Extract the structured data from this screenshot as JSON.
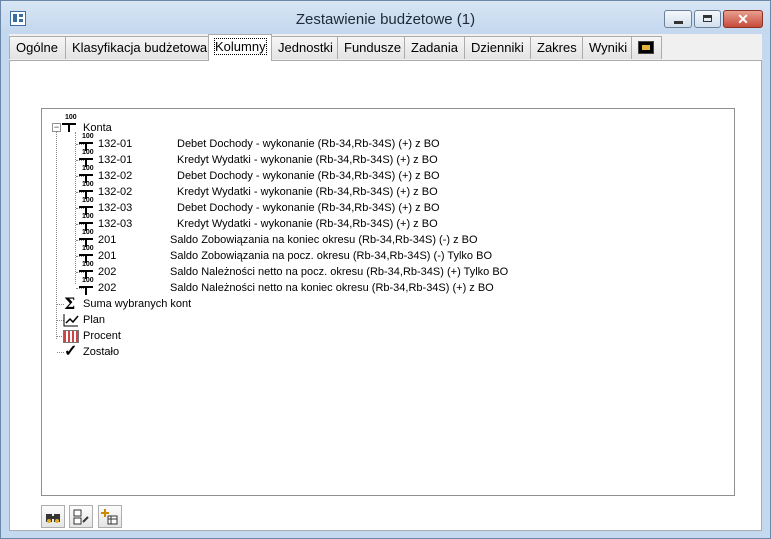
{
  "window": {
    "title": "Zestawienie budżetowe (1)",
    "close_glyph": "✕"
  },
  "tabs": [
    {
      "label": "Ogólne",
      "active": false
    },
    {
      "label": "Klasyfikacja budżetowa",
      "active": false
    },
    {
      "label": "Kolumny",
      "active": true
    },
    {
      "label": "Jednostki",
      "active": false
    },
    {
      "label": "Fundusze",
      "active": false
    },
    {
      "label": "Zadania",
      "active": false
    },
    {
      "label": "Dzienniki",
      "active": false
    },
    {
      "label": "Zakres",
      "active": false
    },
    {
      "label": "Wyniki",
      "active": false
    }
  ],
  "extra_tab_icon": "film-icon",
  "tree": {
    "root": {
      "label": "Konta",
      "icon_text": "100",
      "expander": "−"
    },
    "accounts": [
      {
        "code": "132-01",
        "desc": "Debet Dochody - wykonanie (Rb-34,Rb-34S) (+) z BO"
      },
      {
        "code": "132-01",
        "desc": "Kredyt Wydatki - wykonanie (Rb-34,Rb-34S) (+) z BO"
      },
      {
        "code": "132-02",
        "desc": "Debet Dochody - wykonanie (Rb-34,Rb-34S) (+) z BO"
      },
      {
        "code": "132-02",
        "desc": "Kredyt Wydatki - wykonanie (Rb-34,Rb-34S) (+) z BO"
      },
      {
        "code": "132-03",
        "desc": "Debet Dochody - wykonanie (Rb-34,Rb-34S) (+) z BO"
      },
      {
        "code": "132-03",
        "desc": "Kredyt Wydatki - wykonanie (Rb-34,Rb-34S) (+) z BO"
      },
      {
        "code": "201",
        "desc": "Saldo Zobowiązania na koniec okresu (Rb-34,Rb-34S) (-) z BO"
      },
      {
        "code": "201",
        "desc": "Saldo Zobowiązania na pocz. okresu (Rb-34,Rb-34S) (-) Tylko BO"
      },
      {
        "code": "202",
        "desc": "Saldo Należności netto  na pocz. okresu (Rb-34,Rb-34S) (+) Tylko BO"
      },
      {
        "code": "202",
        "desc": "Saldo Należności netto na koniec okresu (Rb-34,Rb-34S) (+) z BO"
      }
    ],
    "account_icon_text": "100",
    "summary_items": [
      {
        "label": "Suma wybranych kont",
        "icon": "sigma-icon",
        "glyph": "Σ"
      },
      {
        "label": "Plan",
        "icon": "plan-chart-icon",
        "glyph": ""
      },
      {
        "label": "Procent",
        "icon": "percent-icon",
        "glyph": ""
      },
      {
        "label": "Zostało",
        "icon": "checkmark-icon",
        "glyph": "✓"
      }
    ]
  },
  "toolbar": [
    {
      "icon": "binoculars-icon"
    },
    {
      "icon": "tree-edit-icon"
    },
    {
      "icon": "add-item-icon"
    }
  ]
}
